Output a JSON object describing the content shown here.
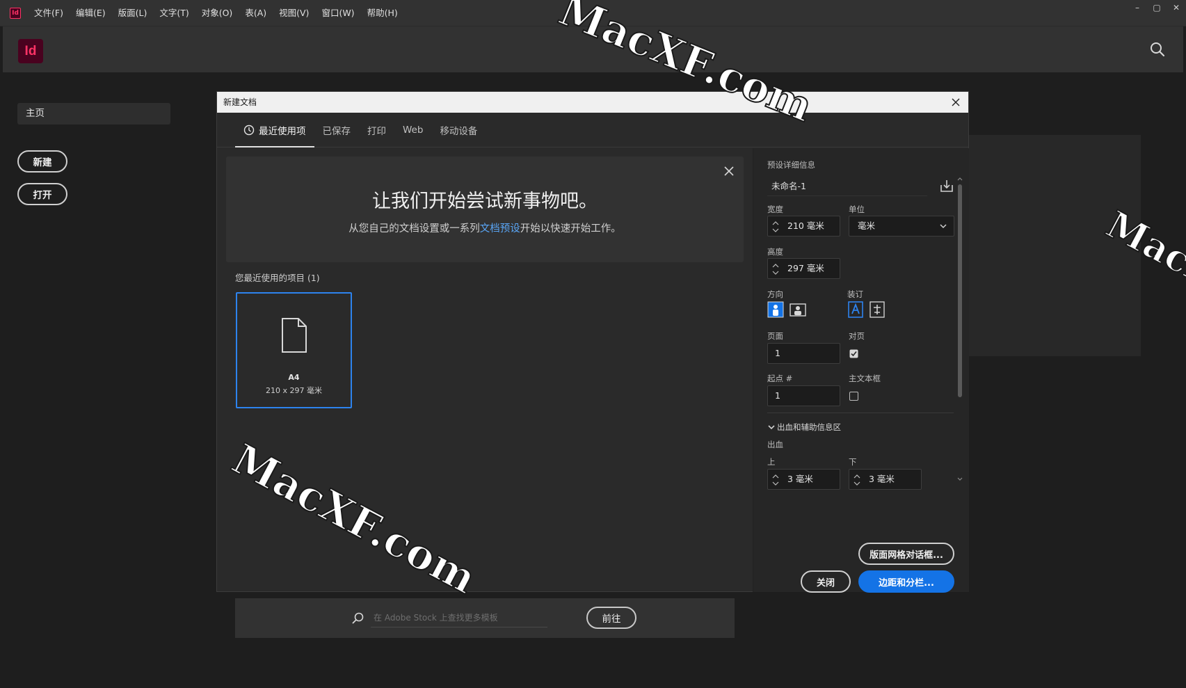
{
  "app": {
    "mini_icon": "Id",
    "logo": "Id",
    "menu": [
      "文件(F)",
      "编辑(E)",
      "版面(L)",
      "文字(T)",
      "对象(O)",
      "表(A)",
      "视图(V)",
      "窗口(W)",
      "帮助(H)"
    ],
    "window_controls": [
      "–",
      "▢",
      "✕"
    ]
  },
  "sidebar": {
    "home_label": "主页",
    "new_label": "新建",
    "open_label": "打开"
  },
  "dialog": {
    "title": "新建文档",
    "tabs": [
      "最近使用项",
      "已保存",
      "打印",
      "Web",
      "移动设备"
    ],
    "welcome": {
      "title": "让我们开始尝试新事物吧。",
      "sub_before": "从您自己的文档设置或一系列",
      "sub_link": "文档预设",
      "sub_after": "开始以快速开始工作。"
    },
    "recent_label": "您最近使用的项目 (1)",
    "recent_items": [
      {
        "name": "A4",
        "size": "210 x 297 毫米"
      }
    ],
    "stock": {
      "placeholder": "在 Adobe Stock 上查找更多模板",
      "go_label": "前往"
    },
    "preset": {
      "header": "预设详细信息",
      "name": "未命名-1",
      "width_label": "宽度",
      "width_value": "210 毫米",
      "unit_label": "单位",
      "unit_value": "毫米",
      "height_label": "高度",
      "height_value": "297 毫米",
      "orientation_label": "方向",
      "binding_label": "装订",
      "pages_label": "页面",
      "pages_value": "1",
      "facing_label": "对页",
      "facing_checked": true,
      "start_label": "起点 #",
      "start_value": "1",
      "primary_frame_label": "主文本框",
      "primary_frame_checked": false,
      "bleed_section": "出血和辅助信息区",
      "bleed_label": "出血",
      "top_label": "上",
      "top_value": "3 毫米",
      "bottom_label": "下",
      "bottom_value": "3 毫米"
    },
    "buttons": {
      "layout_grid": "版面网格对话框...",
      "close": "关闭",
      "margins": "边距和分栏..."
    }
  },
  "watermark": "MacXF.com",
  "colors": {
    "accent": "#1473e6",
    "selection": "#2d83ee",
    "link": "#59a5f5",
    "brand": "#ff3366"
  }
}
